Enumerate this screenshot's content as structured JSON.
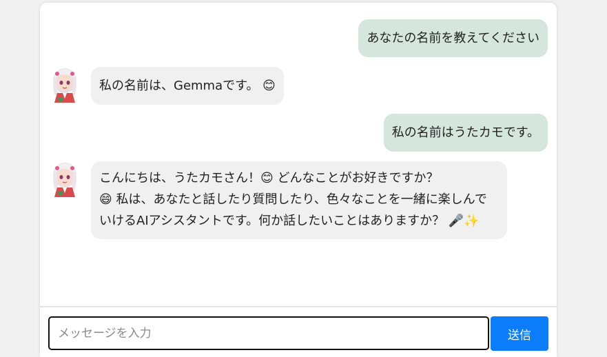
{
  "conversation": {
    "messages": [
      {
        "role": "user",
        "text": "あなたの名前を教えてください"
      },
      {
        "role": "assistant",
        "text": "私の名前は、Gemmaです。 😊"
      },
      {
        "role": "user",
        "text": "私の名前はうたカモです。"
      },
      {
        "role": "assistant",
        "text": "こんにちは、うたカモさん！😊 どんなことがお好きですか？\n😄 私は、あなたと話したり質問したり、色々なことを一緒に楽しんでいけるAIアシスタントです。何か話したいことはありますか？ 🎤✨"
      }
    ]
  },
  "composer": {
    "placeholder": "メッセージを入力",
    "value": "",
    "send_label": "送信"
  },
  "colors": {
    "user_bubble": "#d5e7dd",
    "assistant_bubble": "#f0f0f0",
    "send_button": "#0b7dfa"
  },
  "icons": {
    "assistant_avatar": "anime-girl-avatar"
  }
}
